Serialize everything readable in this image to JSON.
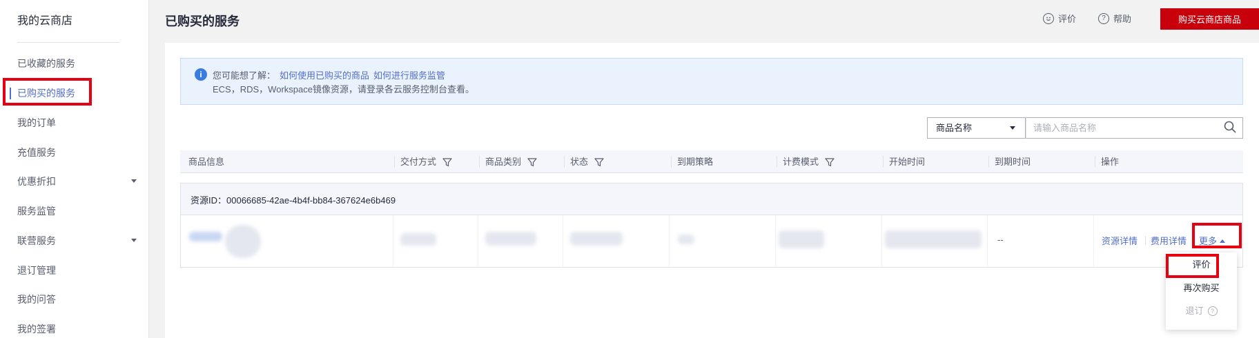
{
  "sidebar": {
    "title": "我的云商店",
    "items": [
      {
        "label": "已收藏的服务",
        "has_caret": false
      },
      {
        "label": "已购买的服务",
        "has_caret": false,
        "active": true
      },
      {
        "label": "我的订单",
        "has_caret": false
      },
      {
        "label": "充值服务",
        "has_caret": false
      },
      {
        "label": "优惠折扣",
        "has_caret": true
      },
      {
        "label": "服务监管",
        "has_caret": false
      },
      {
        "label": "联营服务",
        "has_caret": true
      },
      {
        "label": "退订管理",
        "has_caret": false
      },
      {
        "label": "我的问答",
        "has_caret": false
      },
      {
        "label": "我的签署",
        "has_caret": false
      }
    ]
  },
  "header": {
    "title": "已购买的服务",
    "rate_label": "评价",
    "help_label": "帮助",
    "buy_button": "购买云商店商品"
  },
  "notice": {
    "prefix": "您可能想了解：",
    "link1": "如何使用已购买的商品",
    "link2": "如何进行服务监管",
    "line2": "ECS，RDS，Workspace镜像资源，请登录各云服务控制台查看。"
  },
  "search": {
    "select_value": "商品名称",
    "placeholder": "请输入商品名称"
  },
  "table": {
    "columns": [
      {
        "label": "商品信息",
        "filter": false
      },
      {
        "label": "交付方式",
        "filter": true
      },
      {
        "label": "商品类别",
        "filter": true
      },
      {
        "label": "状态",
        "filter": true
      },
      {
        "label": "到期策略",
        "filter": false
      },
      {
        "label": "计费模式",
        "filter": true
      },
      {
        "label": "开始时间",
        "filter": false
      },
      {
        "label": "到期时间",
        "filter": false
      },
      {
        "label": "操作",
        "filter": false
      }
    ],
    "group_label": "资源ID：00066685-42ae-4b4f-bb84-367624e6b469",
    "row": {
      "expire_time": "--",
      "actions": {
        "detail": "资源详情",
        "fee": "费用详情",
        "more": "更多"
      }
    }
  },
  "dropdown": {
    "items": [
      {
        "label": "评价",
        "disabled": false
      },
      {
        "label": "再次购买",
        "disabled": false
      },
      {
        "label": "退订",
        "disabled": true
      }
    ]
  },
  "colors": {
    "brand_red": "#c7000b",
    "link_blue": "#526ecc",
    "highlight": "#e60012"
  }
}
